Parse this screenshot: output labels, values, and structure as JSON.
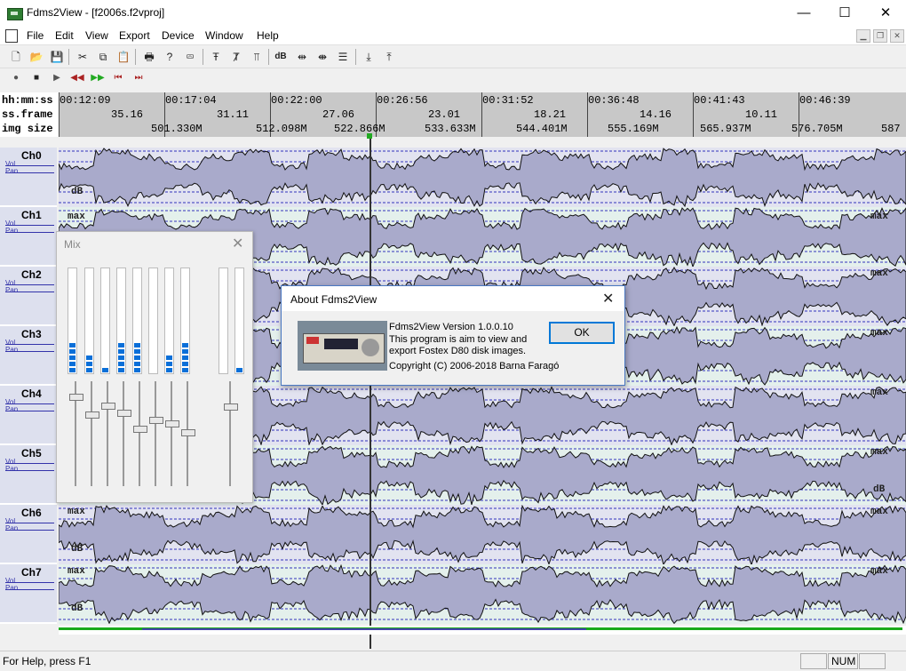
{
  "window": {
    "title": "Fdms2View - [f2006s.f2vproj]",
    "minimize_glyph": "—",
    "maximize_glyph": "☐",
    "close_glyph": "✕"
  },
  "menu": {
    "items": [
      "File",
      "Edit",
      "View",
      "Export",
      "Device",
      "Window",
      "Help"
    ]
  },
  "toolbar": {
    "icons": [
      "new-icon",
      "open-icon",
      "save-icon",
      "cut-icon",
      "copy-icon",
      "paste-icon",
      "print-icon",
      "help-icon",
      "context-help-icon",
      "marker-icon",
      "marker-clear-icon",
      "markers-icon",
      "db-icon",
      "zoom-in-horizontal-icon",
      "zoom-out-horizontal-icon",
      "zoom-fit-icon",
      "export-icon",
      "import-icon"
    ],
    "db_label": "dB"
  },
  "transport": {
    "icons": [
      "record-icon",
      "stop-icon",
      "play-icon",
      "rewind-icon",
      "fast-forward-icon",
      "go-start-icon",
      "go-end-icon"
    ]
  },
  "ruler": {
    "labels": [
      "hh:mm:ss",
      "ss.frame",
      "img size"
    ],
    "times": [
      "00:12:09",
      "00:17:04",
      "00:22:00",
      "00:26:56",
      "00:31:52",
      "00:36:48",
      "00:41:43",
      "00:46:39"
    ],
    "frames": [
      "35.16",
      "31.11",
      "27.06",
      "23.01",
      "18.21",
      "14.16",
      "10.11"
    ],
    "sizes": [
      "501.330M",
      "512.098M",
      "522.866M",
      "533.633M",
      "544.401M",
      "555.169M",
      "565.937M",
      "576.705M",
      "587"
    ]
  },
  "tracks": [
    {
      "name": "Ch0",
      "vol": "Vol",
      "pan": "Pan"
    },
    {
      "name": "Ch1",
      "vol": "Vol",
      "pan": "Pan"
    },
    {
      "name": "Ch2",
      "vol": "Vol",
      "pan": "Pan"
    },
    {
      "name": "Ch3",
      "vol": "Vol",
      "pan": "Pan"
    },
    {
      "name": "Ch4",
      "vol": "Vol",
      "pan": "Pan"
    },
    {
      "name": "Ch5",
      "vol": "Vol",
      "pan": "Pan"
    },
    {
      "name": "Ch6",
      "vol": "Vol",
      "pan": "Pan"
    },
    {
      "name": "Ch7",
      "vol": "Vol",
      "pan": "Pan"
    }
  ],
  "waveform": {
    "max_label": "max",
    "db_label": "dB",
    "fill_color": "#a9aacb",
    "bg_colors": [
      "#e2e3f0",
      "#e4f0ec"
    ]
  },
  "mix": {
    "title": "Mix",
    "close_glyph": "✕",
    "meter_levels": [
      5,
      3,
      1,
      5,
      5,
      0,
      3,
      5,
      0,
      1,
      1
    ]
  },
  "about": {
    "title": "About Fdms2View",
    "close_glyph": "✕",
    "version": "Fdms2View Version 1.0.0.10",
    "desc1": "This program is aim to view and",
    "desc2": "export Fostex D80 disk images.",
    "copyright": "Copyright (C) 2006-2018 Barna Faragó",
    "ok_label": "OK"
  },
  "status": {
    "text": "For Help, press F1",
    "num": "NUM"
  }
}
